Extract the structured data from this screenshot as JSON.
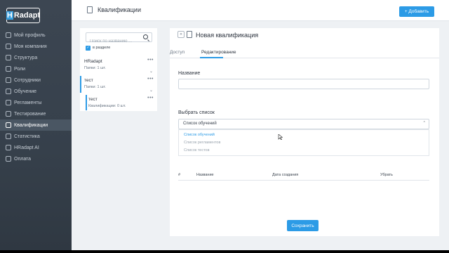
{
  "app": {
    "logo_h": "H",
    "logo_rest": "Radapt"
  },
  "sidebar": {
    "items": [
      {
        "label": "Мой профиль",
        "icon": "user-icon"
      },
      {
        "label": "Моя компания",
        "icon": "building-icon"
      },
      {
        "label": "Структура",
        "icon": "structure-icon"
      },
      {
        "label": "Роли",
        "icon": "roles-icon"
      },
      {
        "label": "Сотрудники",
        "icon": "employees-icon"
      },
      {
        "label": "Обучение",
        "icon": "book-icon"
      },
      {
        "label": "Регламенты",
        "icon": "document-icon"
      },
      {
        "label": "Тестирование",
        "icon": "test-icon"
      },
      {
        "label": "Квалификации",
        "icon": "chart-icon",
        "active": true
      },
      {
        "label": "Статистика",
        "icon": "stats-icon"
      },
      {
        "label": "HRadapt AI",
        "icon": "ai-icon"
      },
      {
        "label": "Оплата",
        "icon": "payment-icon"
      }
    ]
  },
  "header": {
    "title": "Квалификации",
    "add_label": "+ Добавить"
  },
  "left_panel": {
    "search_placeholder": "Поиск по названию ...",
    "checkbox_label": "в разделе",
    "folders": [
      {
        "name": "HRadapt",
        "sub": "Папки: 1 шт."
      },
      {
        "name": "тест",
        "sub": "Папки: 1 шт."
      },
      {
        "name": "тест",
        "sub": "Квалификации: 0 шт."
      }
    ]
  },
  "right_panel": {
    "title": "Новая квалификация",
    "tabs": [
      "Доступ",
      "Редактирование"
    ],
    "name_label": "Название",
    "name_value": "",
    "list_label": "Выбрать список",
    "select_value": "Список обучений",
    "options": [
      "Список обучений",
      "Список регламентов",
      "Список тестов"
    ],
    "table_headers": [
      "#",
      "Название",
      "Дата создания",
      "Убрать"
    ],
    "save_label": "Сохранить"
  },
  "colors": {
    "accent": "#2c9be6",
    "sidebar_bg": "#3c4652",
    "main_bg": "#eef1f4"
  }
}
